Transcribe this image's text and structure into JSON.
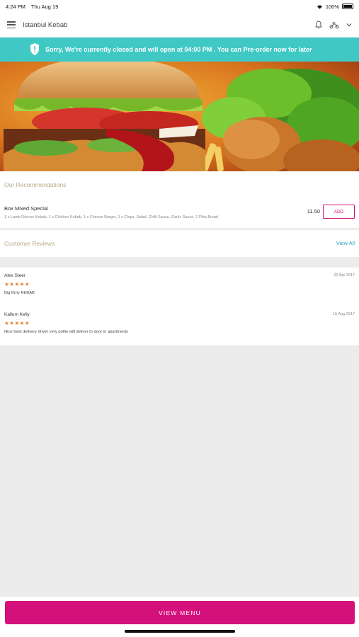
{
  "status_bar": {
    "time": "4:24 PM",
    "date": "Thu Aug 19",
    "battery": "100%"
  },
  "nav": {
    "title": "Istanbul Kebab",
    "icons": [
      "menu-icon",
      "bell-icon",
      "scooter-icon",
      "chevron-down-icon"
    ]
  },
  "notice": {
    "text": "Sorry, We're currently closed and will open at 04:00 PM . You can Pre-order now for later",
    "icon": "shield-alert-icon",
    "color": "#40c8c4"
  },
  "recommendations": {
    "heading": "Our Recommendations",
    "items": [
      {
        "name": "Box Mixed Special",
        "description": "1 x Lamb Donner Kebab, 1 x Chicken Kebab, 1 x Cheese Burger, 1 x Chips, Salad, Chilli Sauce, Garlic Sauce, 2 Pitta Bread",
        "price": "11.50",
        "add_label": "ADD"
      }
    ]
  },
  "reviews": {
    "heading": "Customer Reviews",
    "view_all": "View All",
    "items": [
      {
        "name": "Alex Steer",
        "date": "22 Apr 2017",
        "stars": "★★★★★",
        "rating": 5,
        "text": "Big Dirty KEBAB"
      },
      {
        "name": "Kallum Kelly",
        "date": "15 Aug 2017",
        "stars": "★★★★★",
        "rating": 5,
        "text": "Nice food delivery driver very polite will deliver to door in apartments"
      }
    ]
  },
  "footer": {
    "button_label": "VIEW MENU",
    "accent": "#d4117b"
  }
}
